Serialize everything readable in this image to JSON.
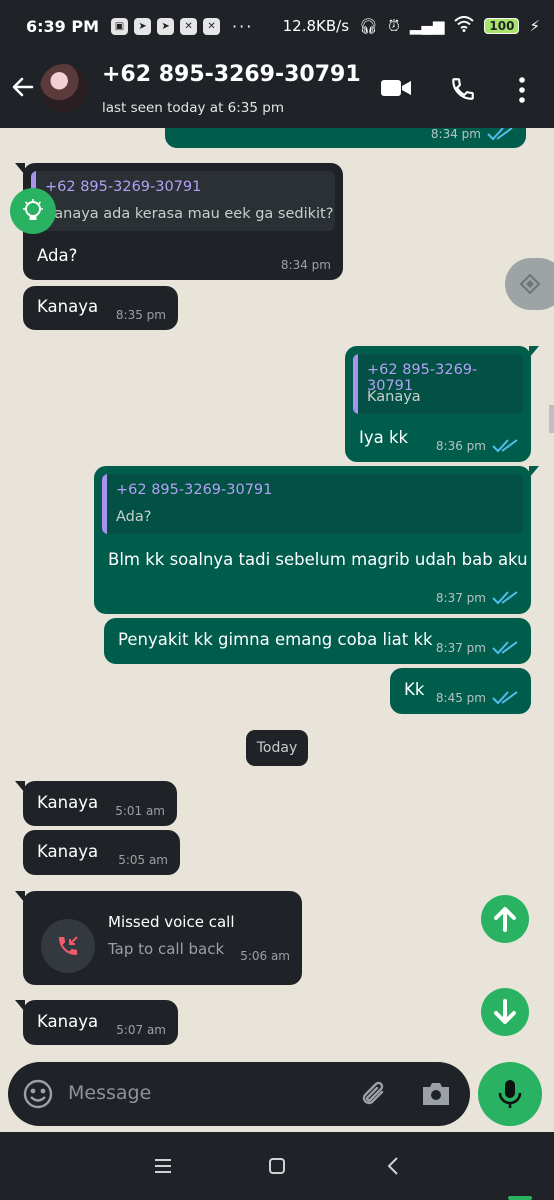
{
  "status_bar": {
    "time": "6:39 PM",
    "dots": "···",
    "net_speed": "12.8KB/s",
    "battery": "100"
  },
  "header": {
    "contact": "+62 895-3269-30791",
    "last_seen": "last seen today at 6:35 pm"
  },
  "messages": [
    {
      "dir": "out",
      "time": "8:34 pm"
    },
    {
      "dir": "in",
      "quote_name": "+62 895-3269-30791",
      "quote_text": "Kanaya ada kerasa mau eek ga sedikit?",
      "text": "Ada?",
      "time": "8:34 pm"
    },
    {
      "dir": "in",
      "text": "Kanaya",
      "time": "8:35 pm"
    },
    {
      "dir": "out",
      "quote_name": "+62 895-3269-30791",
      "quote_text": "Kanaya",
      "text": "Iya kk",
      "time": "8:36 pm"
    },
    {
      "dir": "out",
      "quote_name": "+62 895-3269-30791",
      "quote_text": "Ada?",
      "text": "Blm kk soalnya tadi sebelum magrib udah bab aku",
      "time": "8:37 pm"
    },
    {
      "dir": "out",
      "text": "Penyakit kk gimna emang coba liat kk",
      "time": "8:37 pm"
    },
    {
      "dir": "out",
      "text": "Kk",
      "time": "8:45 pm"
    },
    {
      "dir": "in",
      "text": "Kanaya",
      "time": "5:01 am"
    },
    {
      "dir": "in",
      "text": "Kanaya",
      "time": "5:05 am"
    },
    {
      "dir": "in",
      "call_title": "Missed voice call",
      "call_sub": "Tap to call back",
      "time": "5:06 am"
    },
    {
      "dir": "in",
      "text": "Kanaya",
      "time": "5:07 am"
    }
  ],
  "date_chip": "Today",
  "composer": {
    "placeholder": "Message"
  },
  "colors": {
    "incoming": "#1f2327",
    "outgoing": "#005c4b",
    "accent": "#29b261",
    "ticks": "#53bdeb"
  }
}
